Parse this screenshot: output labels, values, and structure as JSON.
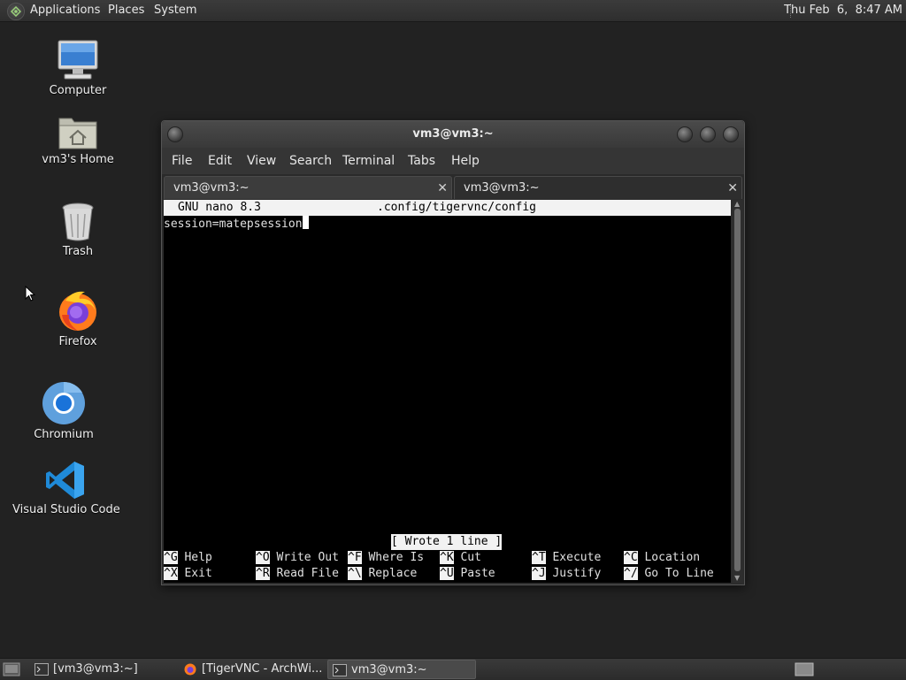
{
  "top_panel": {
    "menus": [
      "Applications",
      "Places",
      "System"
    ],
    "clock": "Thu Feb  6,  8:47 AM"
  },
  "desktop": {
    "icons": [
      {
        "label": "Computer",
        "icon": "computer-icon"
      },
      {
        "label": "vm3's Home",
        "icon": "home-folder-icon"
      },
      {
        "label": "Trash",
        "icon": "trash-icon"
      },
      {
        "label": "Firefox",
        "icon": "firefox-icon"
      },
      {
        "label": "Chromium",
        "icon": "chromium-icon"
      },
      {
        "label": "Visual Studio Code",
        "icon": "vscode-icon"
      }
    ]
  },
  "terminal": {
    "title": "vm3@vm3:~",
    "menu": [
      "File",
      "Edit",
      "View",
      "Search",
      "Terminal",
      "Tabs",
      "Help"
    ],
    "tabs": [
      {
        "label": "vm3@vm3:~",
        "active": true
      },
      {
        "label": "vm3@vm3:~",
        "active": false
      }
    ],
    "nano": {
      "version": "GNU nano 8.3",
      "filename": ".config/tigervnc/config",
      "lines": [
        "session=matepsession"
      ],
      "status": "[ Wrote 1 line ]",
      "shortcuts_row1": [
        {
          "key": "^G",
          "label": "Help"
        },
        {
          "key": "^O",
          "label": "Write Out"
        },
        {
          "key": "^F",
          "label": "Where Is"
        },
        {
          "key": "^K",
          "label": "Cut"
        },
        {
          "key": "^T",
          "label": "Execute"
        },
        {
          "key": "^C",
          "label": "Location"
        }
      ],
      "shortcuts_row2": [
        {
          "key": "^X",
          "label": "Exit"
        },
        {
          "key": "^R",
          "label": "Read File"
        },
        {
          "key": "^\\",
          "label": "Replace"
        },
        {
          "key": "^U",
          "label": "Paste"
        },
        {
          "key": "^J",
          "label": "Justify"
        },
        {
          "key": "^/",
          "label": "Go To Line"
        }
      ]
    }
  },
  "taskbar": {
    "tasks": [
      {
        "label": "[vm3@vm3:~]",
        "icon": "terminal-icon"
      },
      {
        "label": "[TigerVNC - ArchWi...",
        "icon": "firefox-icon"
      },
      {
        "label": "vm3@vm3:~",
        "icon": "terminal-icon",
        "active": true
      }
    ]
  },
  "colors": {
    "desktop_bg": "#222222",
    "panel_bg": "#2e2e2e",
    "nano_bar_bg": "#f2f2f2"
  }
}
